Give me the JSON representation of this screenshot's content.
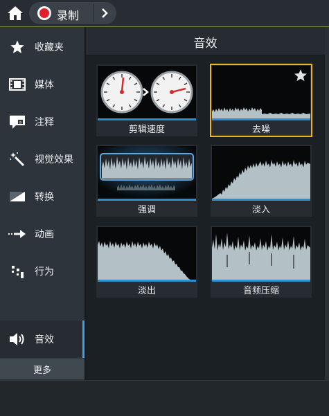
{
  "breadcrumb": {
    "home_icon": "home-icon",
    "record_label": "录制",
    "chevron_icon": "chevron-right-icon"
  },
  "sidebar": {
    "items": [
      {
        "label": "收藏夹",
        "icon": "star-icon"
      },
      {
        "label": "媒体",
        "icon": "film-icon"
      },
      {
        "label": "注释",
        "icon": "annotation-icon"
      },
      {
        "label": "视觉效果",
        "icon": "magic-wand-icon"
      },
      {
        "label": "转换",
        "icon": "transition-icon"
      },
      {
        "label": "动画",
        "icon": "animation-arrow-icon"
      },
      {
        "label": "行为",
        "icon": "behavior-icon"
      },
      {
        "label": "音效",
        "icon": "speaker-icon",
        "active": true
      }
    ],
    "more_label": "更多"
  },
  "main": {
    "title": "音效",
    "tiles": [
      {
        "label": "剪辑速度"
      },
      {
        "label": "去噪",
        "selected": true
      },
      {
        "label": "强调"
      },
      {
        "label": "淡入"
      },
      {
        "label": "淡出"
      },
      {
        "label": "音频压缩"
      }
    ]
  },
  "colors": {
    "accent": "#2b8fd4",
    "selection": "#f0b323",
    "record": "#e21e2c",
    "waveform": "#b3c0c6"
  }
}
